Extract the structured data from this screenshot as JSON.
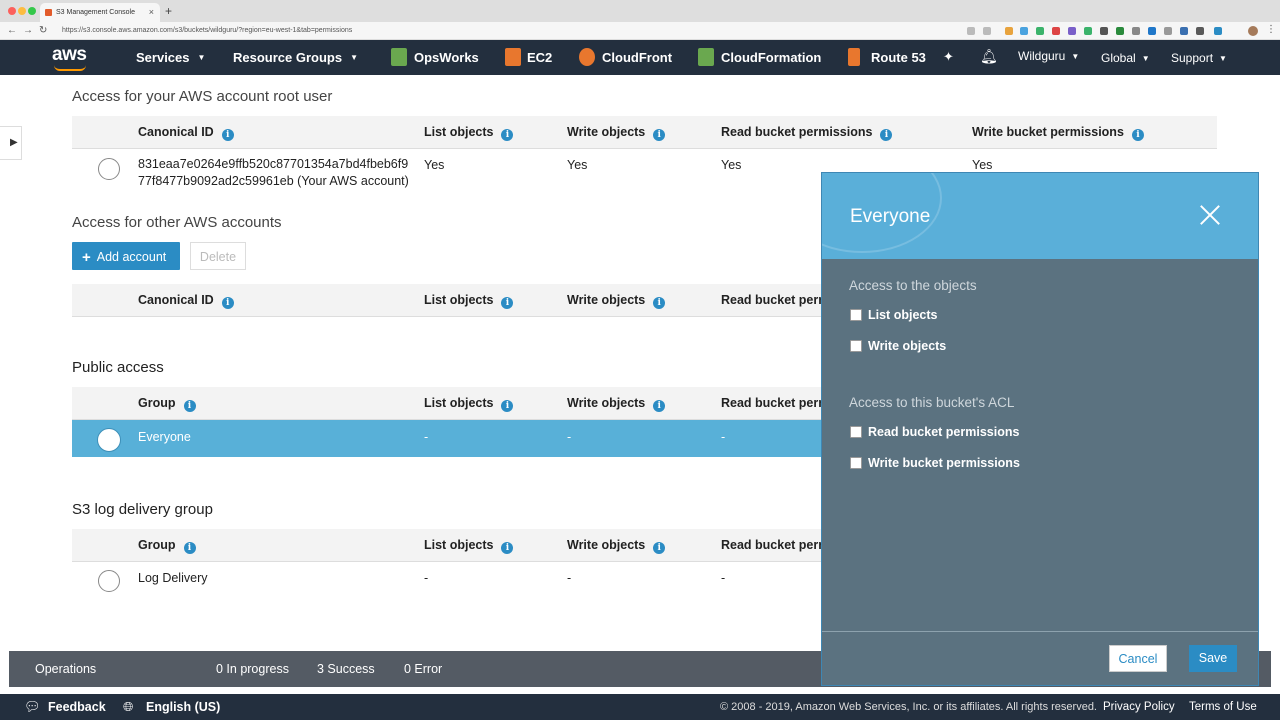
{
  "browser": {
    "tab_title": "S3 Management Console",
    "url": "https://s3.console.aws.amazon.com/s3/buckets/wildguru/?region=eu-west-1&tab=permissions"
  },
  "navbar": {
    "logo": "aws",
    "services": "Services",
    "resource_groups": "Resource Groups",
    "shortcuts": [
      "OpsWorks",
      "EC2",
      "CloudFront",
      "CloudFormation",
      "Route 53"
    ],
    "account": "Wildguru",
    "region": "Global",
    "support": "Support"
  },
  "root_section": {
    "title": "Access for your AWS account root user",
    "headers": [
      "Canonical ID",
      "List objects",
      "Write objects",
      "Read bucket permissions",
      "Write bucket permissions"
    ],
    "row": {
      "id_line1": "831eaa7e0264e9ffb520c87701354a7bd4fbeb6f9",
      "id_line2": "77f8477b9092ad2c59961eb (Your AWS account)",
      "list": "Yes",
      "write": "Yes",
      "read_perm": "Yes",
      "write_perm": "Yes"
    }
  },
  "other_section": {
    "title": "Access for other AWS accounts",
    "add_button": "Add account",
    "delete_button": "Delete",
    "headers": [
      "Canonical ID",
      "List objects",
      "Write objects",
      "Read bucket permi"
    ]
  },
  "public_section": {
    "title": "Public access",
    "headers": [
      "Group",
      "List objects",
      "Write objects",
      "Read bucket perm"
    ],
    "row": {
      "group": "Everyone",
      "list": "-",
      "write": "-",
      "read_perm": "-"
    }
  },
  "log_section": {
    "title": "S3 log delivery group",
    "headers": [
      "Group",
      "List objects",
      "Write objects",
      "Read bucket perm"
    ],
    "row": {
      "group": "Log Delivery",
      "list": "-",
      "write": "-",
      "read_perm": "-"
    }
  },
  "operations": {
    "label": "Operations",
    "in_progress": "0 In progress",
    "success": "3 Success",
    "error": "0 Error"
  },
  "footer": {
    "feedback": "Feedback",
    "language": "English (US)",
    "copyright": "© 2008 - 2019, Amazon Web Services, Inc. or its affiliates. All rights reserved.",
    "privacy": "Privacy Policy",
    "terms": "Terms of Use"
  },
  "panel": {
    "title": "Everyone",
    "objects_section": "Access to the objects",
    "list_objects": "List objects",
    "write_objects": "Write objects",
    "acl_section": "Access to this bucket's ACL",
    "read_perms": "Read bucket permissions",
    "write_perms": "Write bucket permissions",
    "cancel": "Cancel",
    "save": "Save"
  },
  "colors": {
    "nav_bg": "#232f3e",
    "accent": "#2b8cc4",
    "panel_header": "#5aafd9",
    "panel_body": "#5b7280",
    "selected_row": "#58b0d8"
  }
}
